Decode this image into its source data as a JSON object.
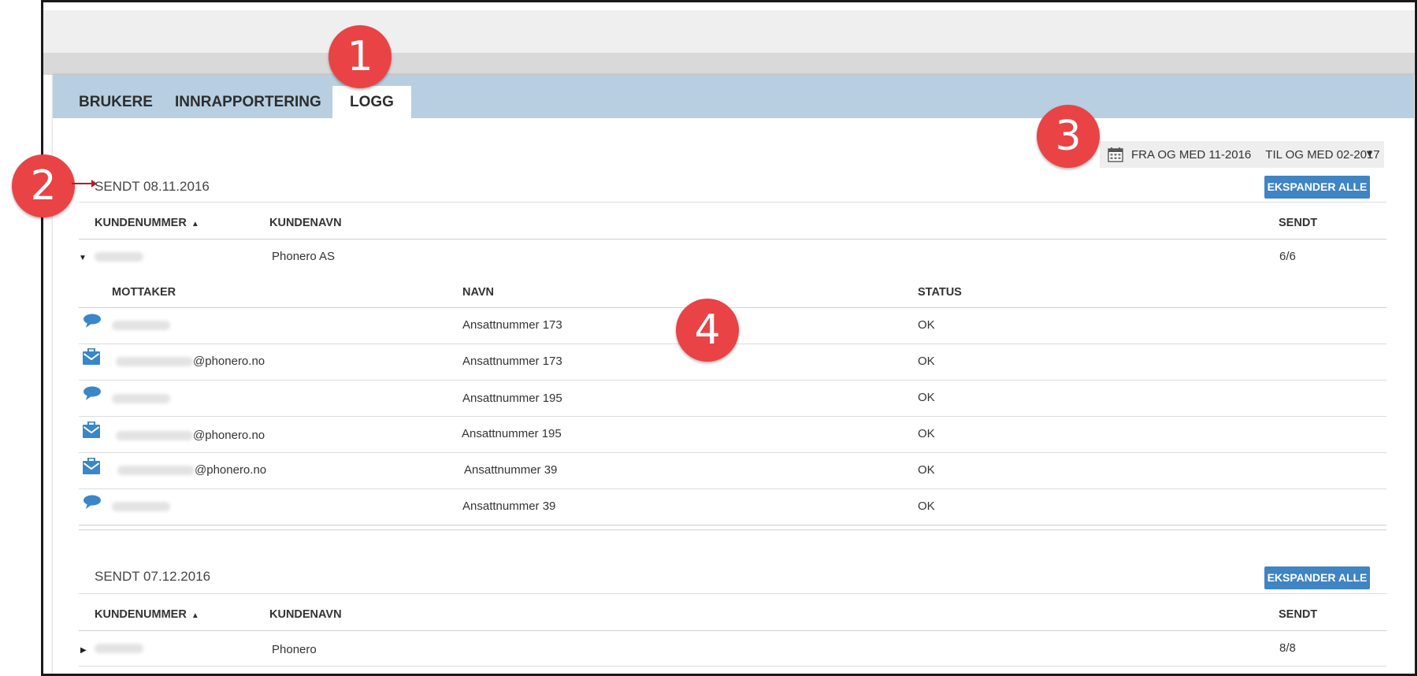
{
  "tabs": [
    {
      "label": "BRUKERE"
    },
    {
      "label": "INNRAPPORTERING"
    },
    {
      "label": "LOGG"
    }
  ],
  "date_filter": {
    "from": "FRA OG MED 11-2016",
    "to": "TIL OG MED 02-2017"
  },
  "annotations": [
    "1",
    "2",
    "3",
    "4"
  ],
  "groups": [
    {
      "title": "SENDT 08.11.2016",
      "expand_label": "EKSPANDER ALLE",
      "headers": {
        "kundenummer": "KUNDENUMMER",
        "kundenavn": "KUNDENAVN",
        "sendt": "SENDT"
      },
      "customer": {
        "name": "Phonero AS",
        "sent": "6/6"
      },
      "detail_headers": {
        "mottaker": "MOTTAKER",
        "navn": "NAVN",
        "status": "STATUS"
      },
      "rows": [
        {
          "type": "sms",
          "recipient_suffix": "",
          "name": "Ansattnummer 173",
          "status": "OK"
        },
        {
          "type": "email",
          "recipient_suffix": "@phonero.no",
          "name": "Ansattnummer 173",
          "status": "OK"
        },
        {
          "type": "sms",
          "recipient_suffix": "",
          "name": "Ansattnummer 195",
          "status": "OK"
        },
        {
          "type": "email",
          "recipient_suffix": "@phonero.no",
          "name": "Ansattnummer 195",
          "status": "OK"
        },
        {
          "type": "email",
          "recipient_suffix": "@phonero.no",
          "name": "Ansattnummer 39",
          "status": "OK"
        },
        {
          "type": "sms",
          "recipient_suffix": "",
          "name": "Ansattnummer 39",
          "status": "OK"
        }
      ]
    },
    {
      "title": "SENDT 07.12.2016",
      "expand_label": "EKSPANDER ALLE",
      "headers": {
        "kundenummer": "KUNDENUMMER",
        "kundenavn": "KUNDENAVN",
        "sendt": "SENDT"
      },
      "customer": {
        "name": "Phonero",
        "sent": "8/8"
      }
    }
  ],
  "icons": {
    "sms": "speech-bubble-icon",
    "email": "mail-briefcase-icon",
    "calendar": "calendar-icon",
    "dropdown": "caret-down-icon"
  },
  "colors": {
    "tabbar": "#b8cfe2",
    "accent": "#3f84c3",
    "badge": "#e94346",
    "icon": "#3a86c8"
  }
}
